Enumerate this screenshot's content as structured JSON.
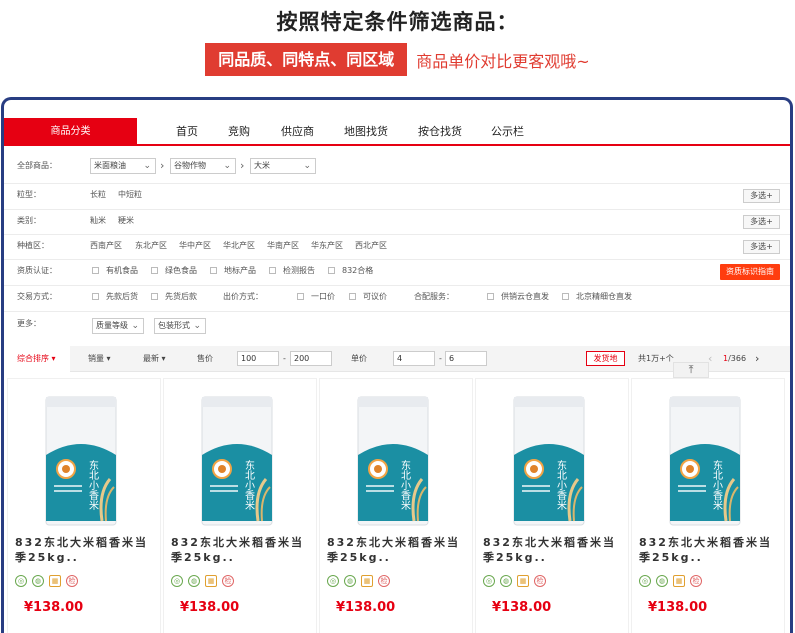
{
  "banner": {
    "headline": "按照特定条件筛选商品：",
    "tag": "同品质、同特点、同区域",
    "note": "商品单价对比更客观哦~"
  },
  "nav": {
    "category_button": "商品分类",
    "items": [
      "首页",
      "竞购",
      "供应商",
      "地图找货",
      "按仓找货",
      "公示栏"
    ]
  },
  "filters": {
    "all_goods": {
      "label": "全部商品：",
      "selects": [
        "米面粮油",
        "谷物作物",
        "大米"
      ]
    },
    "grain_type": {
      "label": "粒型：",
      "options": [
        "长粒",
        "中短粒"
      ],
      "more": "多选+"
    },
    "category": {
      "label": "类别：",
      "options": [
        "籼米",
        "粳米"
      ],
      "more": "多选+"
    },
    "region": {
      "label": "种植区：",
      "options": [
        "西南产区",
        "东北产区",
        "华中产区",
        "华北产区",
        "华南产区",
        "华东产区",
        "西北产区"
      ],
      "more": "多选+"
    },
    "certification": {
      "label": "资质认证：",
      "options": [
        "有机食品",
        "绿色食品",
        "地标产品",
        "检测报告",
        "832合格"
      ],
      "guide_button": "资质标识指南"
    },
    "trade": {
      "label": "交易方式：",
      "options": [
        "先款后货",
        "先货后款"
      ],
      "pay_label": "出价方式：",
      "pay_options": [
        "一口价",
        "可议价"
      ],
      "service_label": "合配服务：",
      "service_options": [
        "供销云仓直发",
        "北京精细仓直发"
      ]
    },
    "more": {
      "label": "更多：",
      "selects": [
        "质量等级",
        "包装形式"
      ]
    }
  },
  "sortbar": {
    "comprehensive": "综合排序",
    "sales": "销量",
    "newest": "最新",
    "total_price_label": "售价",
    "total_price_min": "100",
    "total_price_max": "200",
    "dash": "-",
    "unit_price_label": "单价",
    "unit_price_min": "4",
    "unit_price_max": "6",
    "ship_button": "发货地",
    "total_count": "共1万+个",
    "page_current": "1",
    "page_total": "/366"
  },
  "products": [
    {
      "title": "832东北大米稻香米当季25kg..",
      "price": "¥138.00",
      "brand": "东北小香米"
    },
    {
      "title": "832东北大米稻香米当季25kg..",
      "price": "¥138.00",
      "brand": "东北小香米"
    },
    {
      "title": "832东北大米稻香米当季25kg..",
      "price": "¥138.00",
      "brand": "东北小香米"
    },
    {
      "title": "832东北大米稻香米当季25kg..",
      "price": "¥138.00",
      "brand": "东北小香米"
    },
    {
      "title": "832东北大米稻香米当季25kg..",
      "price": "¥138.00",
      "brand": "东北小香米"
    }
  ],
  "badge_icons": [
    "organic-icon",
    "green-food-icon",
    "geo-product-icon",
    "check-report-icon"
  ],
  "colors": {
    "accent": "#e60012",
    "frame": "#283d82",
    "bag_teal": "#1b8fa3"
  }
}
